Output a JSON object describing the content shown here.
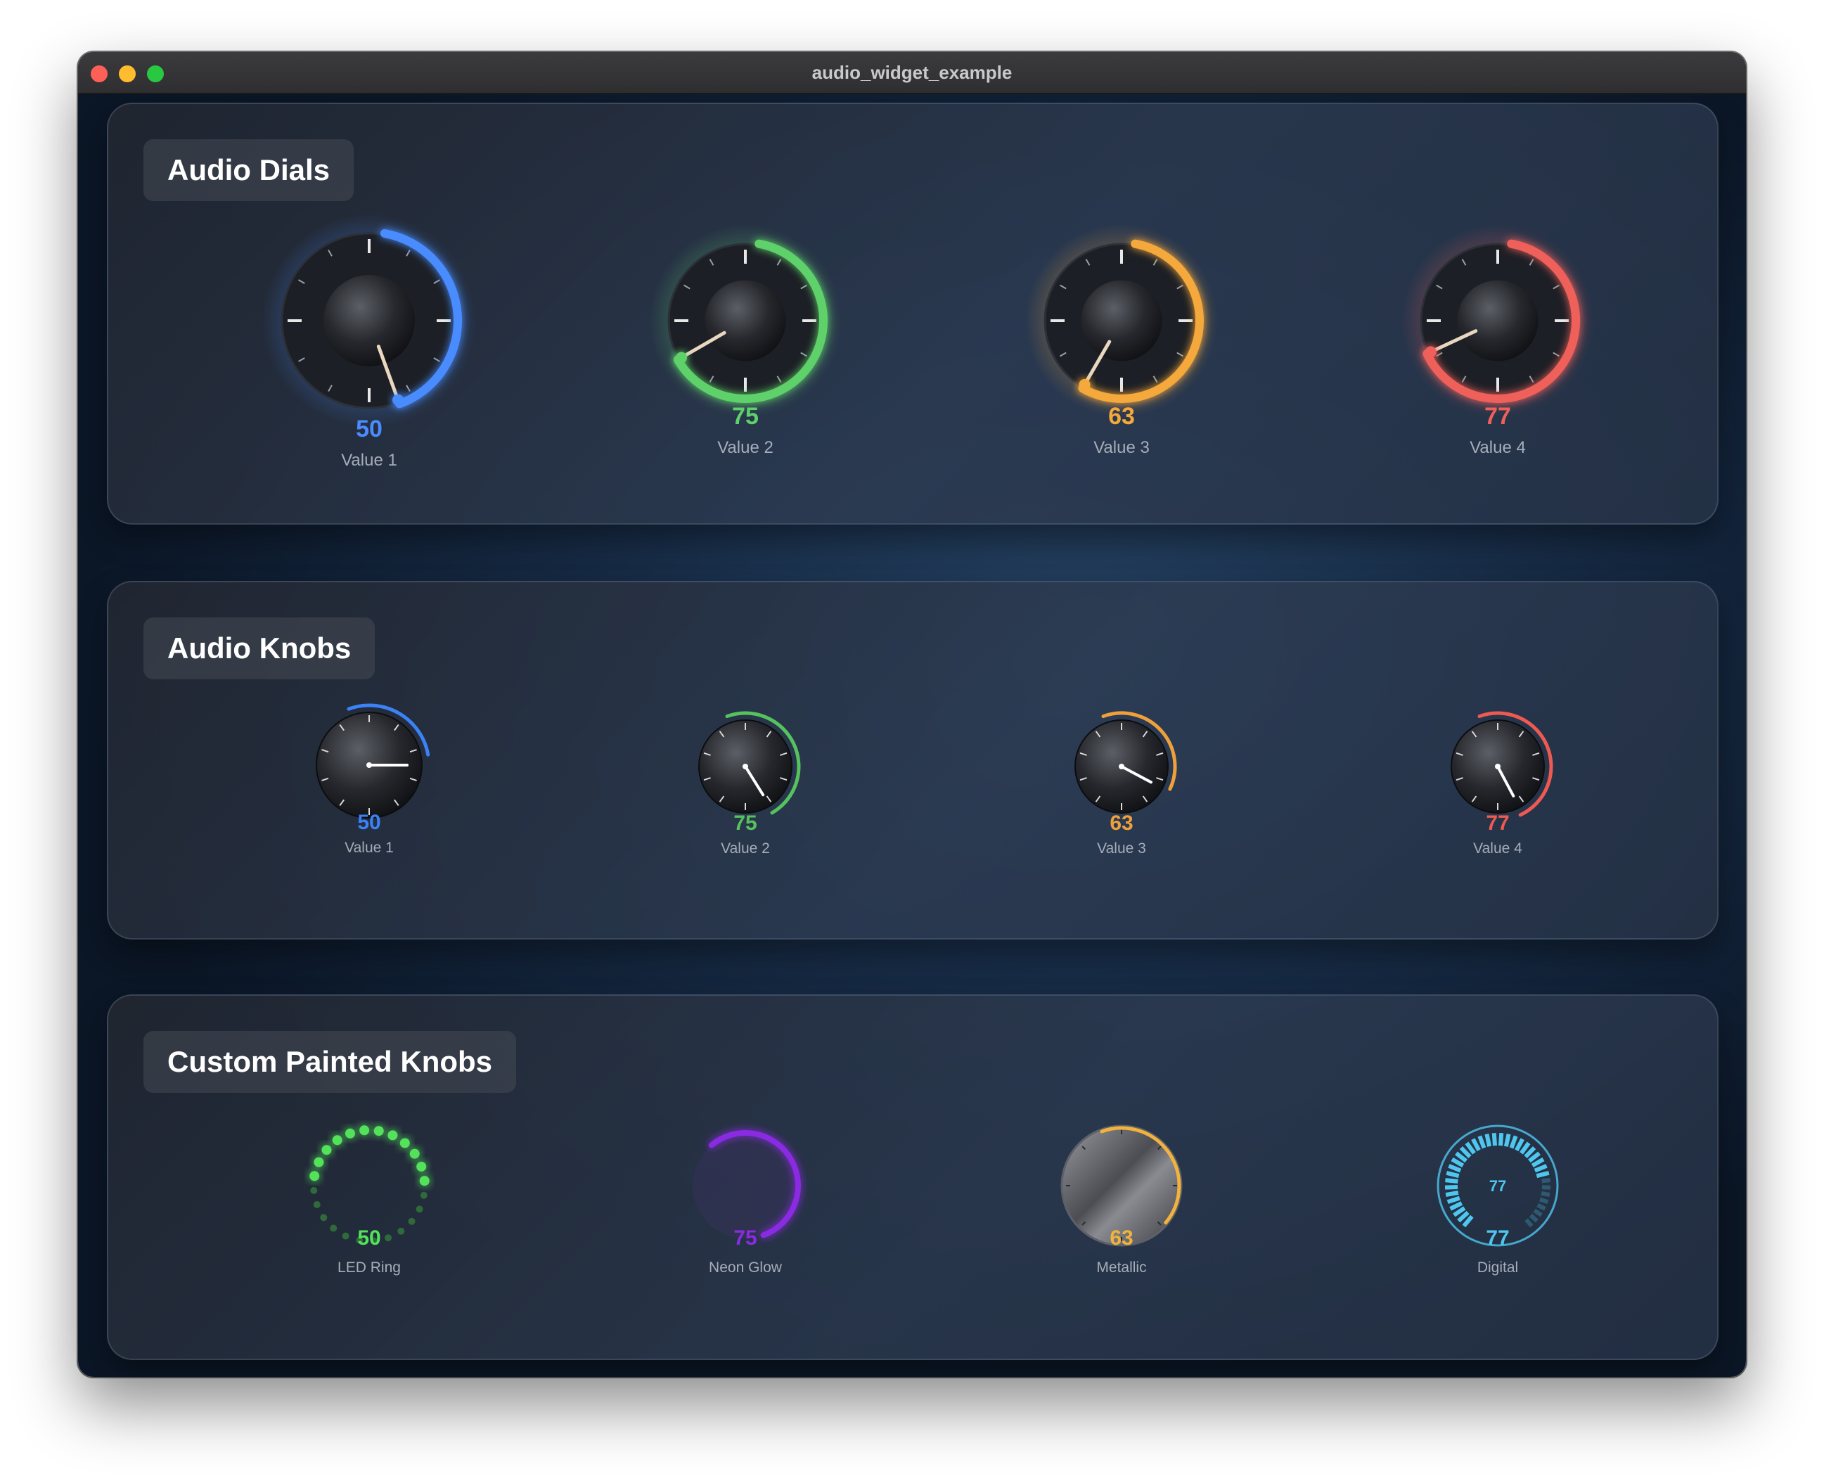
{
  "window": {
    "title": "audio_widget_example"
  },
  "sections": {
    "dials": {
      "title": "Audio Dials",
      "items": [
        {
          "value": "50",
          "label": "Value 1",
          "color": "#4a8cff"
        },
        {
          "value": "75",
          "label": "Value 2",
          "color": "#5fd16a"
        },
        {
          "value": "63",
          "label": "Value 3",
          "color": "#f5a83a"
        },
        {
          "value": "77",
          "label": "Value 4",
          "color": "#f0605a"
        }
      ]
    },
    "knobs": {
      "title": "Audio Knobs",
      "items": [
        {
          "value": "50",
          "label": "Value 1",
          "color": "#3b82f6"
        },
        {
          "value": "75",
          "label": "Value 2",
          "color": "#56c25e"
        },
        {
          "value": "63",
          "label": "Value 3",
          "color": "#f0a03a"
        },
        {
          "value": "77",
          "label": "Value 4",
          "color": "#ee5a52"
        }
      ]
    },
    "custom": {
      "title": "Custom Painted Knobs",
      "items": [
        {
          "value": "50",
          "label": "LED Ring",
          "color": "#52e35a",
          "style": "led"
        },
        {
          "value": "75",
          "label": "Neon Glow",
          "color": "#8a2be2",
          "style": "neon"
        },
        {
          "value": "63",
          "label": "Metallic",
          "color": "#f2b33d",
          "style": "metallic"
        },
        {
          "value": "77",
          "label": "Digital",
          "color": "#4fc6ee",
          "style": "digital",
          "center_text": "77"
        }
      ]
    }
  }
}
